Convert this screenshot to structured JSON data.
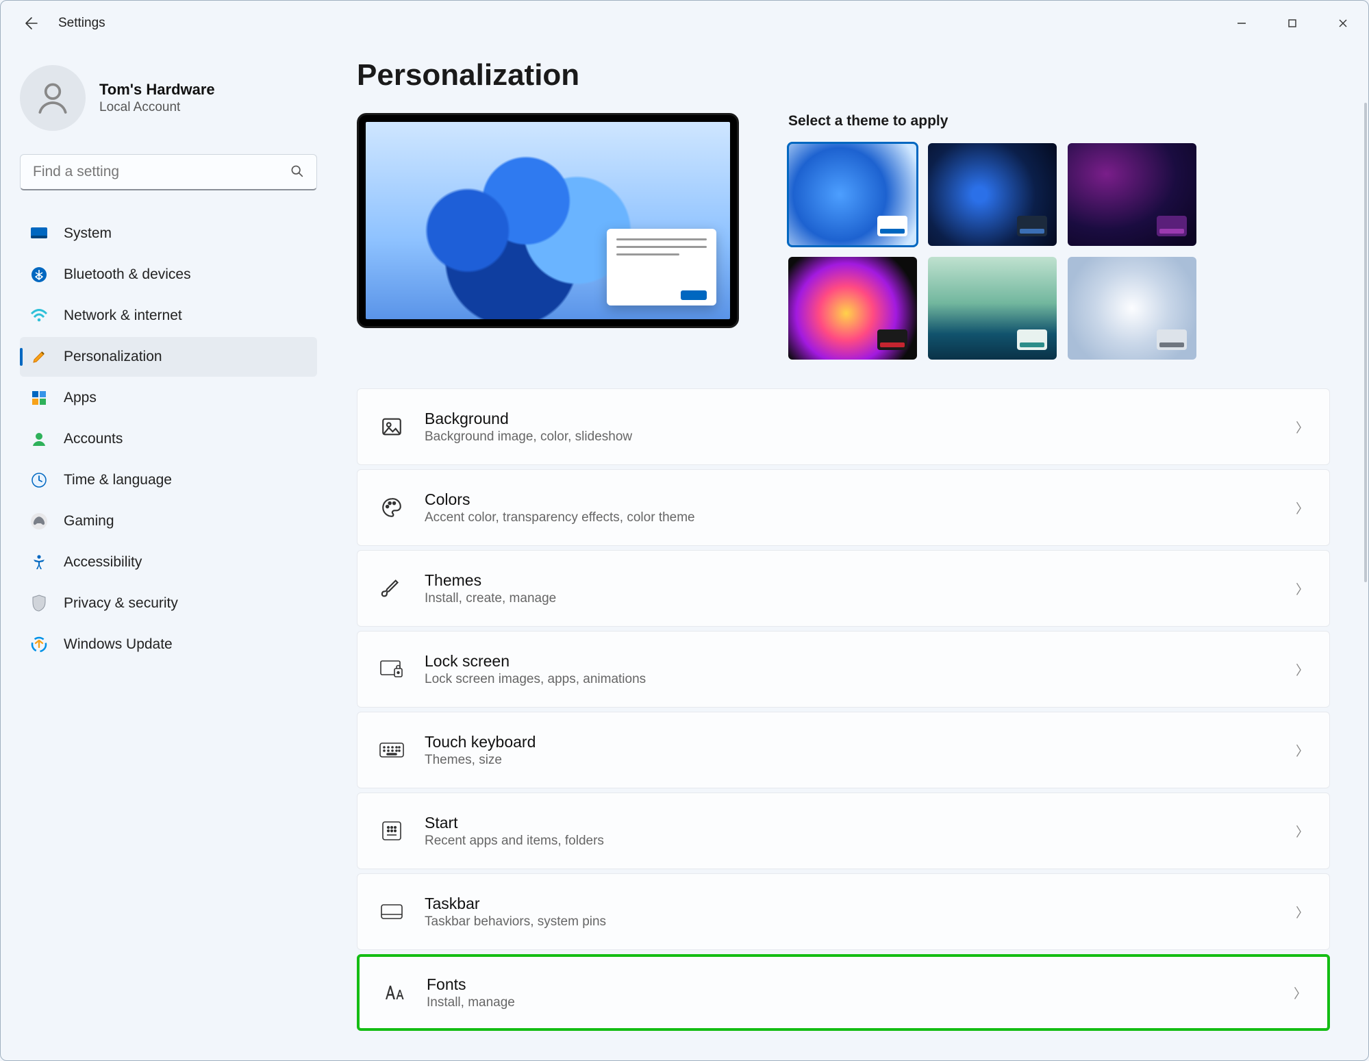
{
  "window": {
    "title": "Settings"
  },
  "user": {
    "name": "Tom's Hardware",
    "subtitle": "Local Account"
  },
  "search": {
    "placeholder": "Find a setting"
  },
  "sidebar": {
    "items": [
      {
        "label": "System"
      },
      {
        "label": "Bluetooth & devices"
      },
      {
        "label": "Network & internet"
      },
      {
        "label": "Personalization"
      },
      {
        "label": "Apps"
      },
      {
        "label": "Accounts"
      },
      {
        "label": "Time & language"
      },
      {
        "label": "Gaming"
      },
      {
        "label": "Accessibility"
      },
      {
        "label": "Privacy & security"
      },
      {
        "label": "Windows Update"
      }
    ]
  },
  "main": {
    "title": "Personalization",
    "theme_heading": "Select a theme to apply",
    "rows": [
      {
        "title": "Background",
        "sub": "Background image, color, slideshow"
      },
      {
        "title": "Colors",
        "sub": "Accent color, transparency effects, color theme"
      },
      {
        "title": "Themes",
        "sub": "Install, create, manage"
      },
      {
        "title": "Lock screen",
        "sub": "Lock screen images, apps, animations"
      },
      {
        "title": "Touch keyboard",
        "sub": "Themes, size"
      },
      {
        "title": "Start",
        "sub": "Recent apps and items, folders"
      },
      {
        "title": "Taskbar",
        "sub": "Taskbar behaviors, system pins"
      },
      {
        "title": "Fonts",
        "sub": "Install, manage"
      }
    ]
  },
  "colors": {
    "accent": "#0067c0",
    "highlight": "#14bd14"
  }
}
